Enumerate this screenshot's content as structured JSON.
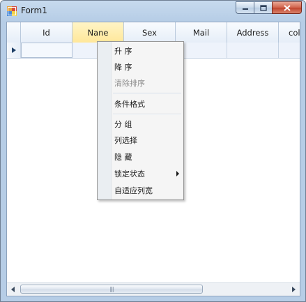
{
  "window": {
    "title": "Form1"
  },
  "grid": {
    "columns": [
      {
        "label": "Id",
        "selected": false
      },
      {
        "label": "Nane",
        "selected": true
      },
      {
        "label": "Sex",
        "selected": false
      },
      {
        "label": "Mail",
        "selected": false
      },
      {
        "label": "Address",
        "selected": false
      },
      {
        "label": "col",
        "selected": false
      }
    ]
  },
  "context_menu": {
    "items": [
      {
        "label": "升 序",
        "disabled": false
      },
      {
        "label": "降 序",
        "disabled": false
      },
      {
        "label": "清除排序",
        "disabled": true
      },
      {
        "label": "条件格式",
        "disabled": false
      },
      {
        "label": "分 组",
        "disabled": false
      },
      {
        "label": "列选择",
        "disabled": false
      },
      {
        "label": "隐 藏",
        "disabled": false
      },
      {
        "label": "锁定状态",
        "disabled": false,
        "has_submenu": true
      },
      {
        "label": "自适应列宽",
        "disabled": false
      }
    ]
  },
  "icons": {
    "app": "form-app-icon",
    "minimize": "minimize-icon",
    "maximize": "maximize-icon",
    "close": "close-icon",
    "row_indicator": "current-row-arrow-icon",
    "submenu": "submenu-arrow-icon"
  },
  "colors": {
    "selected_header": "#ffe79a",
    "close_button": "#c0432c",
    "title_bar": "#b6cde6"
  }
}
